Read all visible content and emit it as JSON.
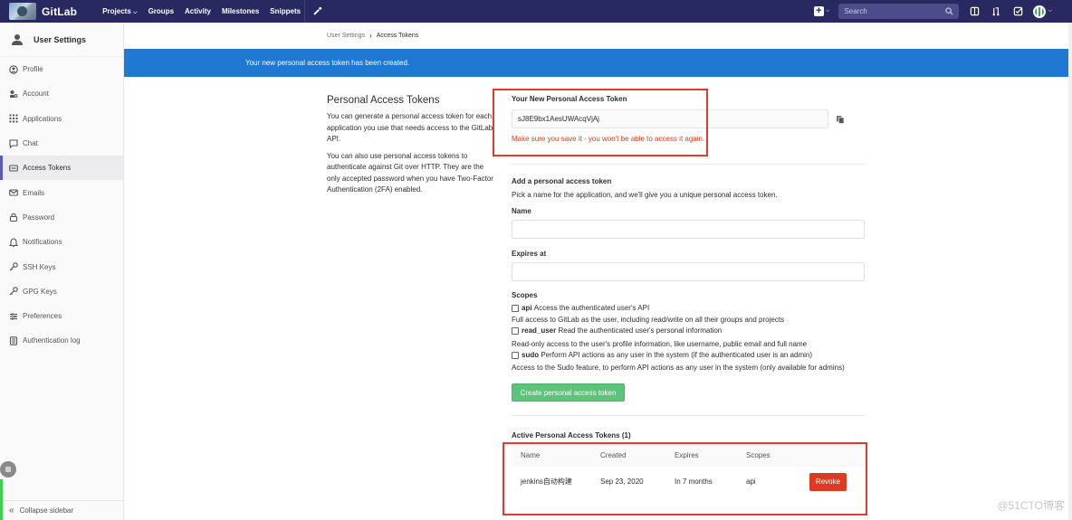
{
  "navbar": {
    "brand": "GitLab",
    "links": [
      "Projects",
      "Groups",
      "Activity",
      "Milestones",
      "Snippets"
    ],
    "search_placeholder": "Search"
  },
  "sidebar": {
    "title": "User Settings",
    "items": [
      {
        "label": "Profile",
        "icon": "profile-icon"
      },
      {
        "label": "Account",
        "icon": "account-icon"
      },
      {
        "label": "Applications",
        "icon": "applications-icon"
      },
      {
        "label": "Chat",
        "icon": "chat-icon"
      },
      {
        "label": "Access Tokens",
        "icon": "access-tokens-icon",
        "active": true
      },
      {
        "label": "Emails",
        "icon": "emails-icon"
      },
      {
        "label": "Password",
        "icon": "password-icon"
      },
      {
        "label": "Notifications",
        "icon": "notifications-icon"
      },
      {
        "label": "SSH Keys",
        "icon": "ssh-keys-icon"
      },
      {
        "label": "GPG Keys",
        "icon": "gpg-keys-icon"
      },
      {
        "label": "Preferences",
        "icon": "preferences-icon"
      },
      {
        "label": "Authentication log",
        "icon": "authentication-log-icon"
      }
    ],
    "collapse_label": "Collapse sidebar"
  },
  "breadcrumb": {
    "parent": "User Settings",
    "current": "Access Tokens"
  },
  "banner": "Your new personal access token has been created.",
  "intro": {
    "title": "Personal Access Tokens",
    "p1": "You can generate a personal access token for each application you use that needs access to the GitLab API.",
    "p2": "You can also use personal access tokens to authenticate against Git over HTTP. They are the only accepted password when you have Two-Factor Authentication (2FA) enabled."
  },
  "new_token": {
    "label": "Your New Personal Access Token",
    "value": "sJ8E9bx1AesUWAcqVjAj",
    "warning": "Make sure you save it - you won't be able to access it again."
  },
  "form": {
    "heading": "Add a personal access token",
    "subheading": "Pick a name for the application, and we'll give you a unique personal access token.",
    "name_label": "Name",
    "expires_label": "Expires at",
    "scopes_label": "Scopes",
    "scopes": [
      {
        "name": "api",
        "summary": "Access the authenticated user's API",
        "desc": "Full access to GitLab as the user, including read/write on all their groups and projects"
      },
      {
        "name": "read_user",
        "summary": "Read the authenticated user's personal information",
        "desc": "Read-only access to the user's profile information, like username, public email and full name"
      },
      {
        "name": "sudo",
        "summary": "Perform API actions as any user in the system (if the authenticated user is an admin)",
        "desc": "Access to the Sudo feature, to perform API actions as any user in the system (only available for admins)"
      }
    ],
    "submit_label": "Create personal access token"
  },
  "active_tokens": {
    "heading": "Active Personal Access Tokens (1)",
    "columns": [
      "Name",
      "Created",
      "Expires",
      "Scopes"
    ],
    "rows": [
      {
        "name": "jenkins自动构建",
        "created": "Sep 23, 2020",
        "expires": "In 7 months",
        "scopes": "api",
        "action": "Revoke"
      }
    ]
  },
  "watermark": "@51CTO博客",
  "colors": {
    "navbar": "#292961",
    "banner": "#1f78d1",
    "create_button": "#5cc47a",
    "revoke_button": "#db3b21",
    "warning": "#db3b21",
    "highlight_box": "#e43a2e"
  }
}
